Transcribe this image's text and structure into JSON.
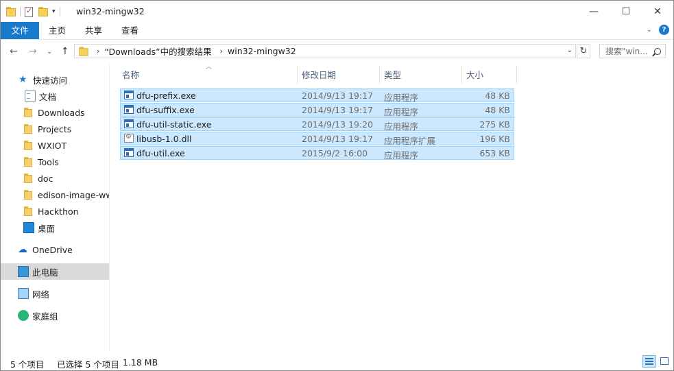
{
  "window": {
    "title": "win32-mingw32",
    "controls": {
      "minimize": "—",
      "maximize": "☐",
      "close": "✕"
    }
  },
  "ribbon": {
    "tabs": [
      {
        "label": "文件",
        "active": true
      },
      {
        "label": "主页"
      },
      {
        "label": "共享"
      },
      {
        "label": "查看"
      }
    ],
    "help_label": "?"
  },
  "address": {
    "crumbs": [
      "“Downloads”中的搜索结果",
      "win32-mingw32"
    ],
    "search_placeholder": "搜索\"win..."
  },
  "nav": {
    "items": [
      {
        "label": "快速访问",
        "icon": "star-icon"
      },
      {
        "label": "文档",
        "icon": "document-icon",
        "pinned": true
      },
      {
        "label": "Downloads",
        "icon": "folder-icon",
        "pinned": true
      },
      {
        "label": "Projects",
        "icon": "folder-icon",
        "pinned": true
      },
      {
        "label": "WXIOT",
        "icon": "folder-icon",
        "pinned": true
      },
      {
        "label": "Tools",
        "icon": "folder-icon",
        "pinned": true
      },
      {
        "label": "doc",
        "icon": "folder-icon"
      },
      {
        "label": "edison-image-ww",
        "icon": "folder-icon"
      },
      {
        "label": "Hackthon",
        "icon": "folder-icon"
      },
      {
        "label": "桌面",
        "icon": "desktop-icon"
      },
      {
        "label": "OneDrive",
        "icon": "cloud-icon"
      },
      {
        "label": "此电脑",
        "icon": "computer-icon",
        "selected": true
      },
      {
        "label": "网络",
        "icon": "network-icon"
      },
      {
        "label": "家庭组",
        "icon": "homegroup-icon"
      }
    ]
  },
  "columns": {
    "name": "名称",
    "date": "修改日期",
    "type": "类型",
    "size": "大小"
  },
  "files": [
    {
      "name": "dfu-prefix.exe",
      "date": "2014/9/13 19:17",
      "type": "应用程序",
      "size": "48 KB",
      "icon": "exe"
    },
    {
      "name": "dfu-suffix.exe",
      "date": "2014/9/13 19:17",
      "type": "应用程序",
      "size": "48 KB",
      "icon": "exe"
    },
    {
      "name": "dfu-util-static.exe",
      "date": "2014/9/13 19:20",
      "type": "应用程序",
      "size": "275 KB",
      "icon": "exe"
    },
    {
      "name": "libusb-1.0.dll",
      "date": "2014/9/13 19:17",
      "type": "应用程序扩展",
      "size": "196 KB",
      "icon": "dll"
    },
    {
      "name": "dfu-util.exe",
      "date": "2015/9/2 16:00",
      "type": "应用程序",
      "size": "653 KB",
      "icon": "exe"
    }
  ],
  "status": {
    "count": "5 个项目",
    "selected": "已选择 5 个项目",
    "size": "1.18 MB"
  }
}
